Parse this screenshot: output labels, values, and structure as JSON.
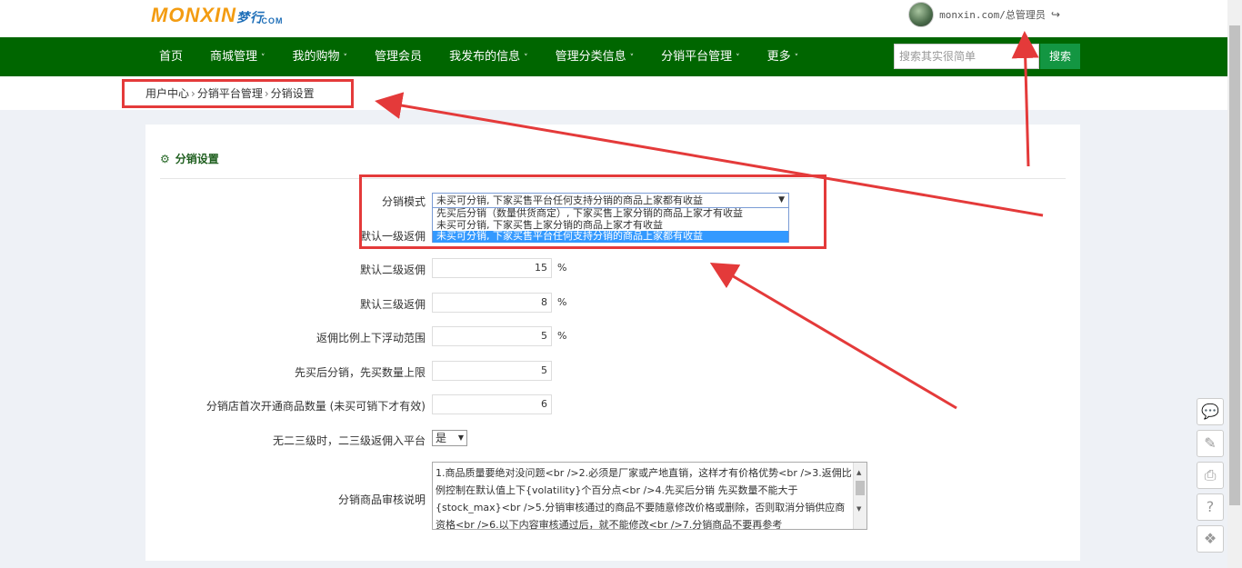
{
  "header": {
    "logo_main": "MONXIN",
    "logo_cn": "梦行",
    "logo_com": ".COM",
    "user": "monxin.com/总管理员"
  },
  "nav": {
    "items": [
      {
        "label": "首页",
        "has_caret": false
      },
      {
        "label": "商城管理",
        "has_caret": true
      },
      {
        "label": "我的购物",
        "has_caret": true
      },
      {
        "label": "管理会员",
        "has_caret": false
      },
      {
        "label": "我发布的信息",
        "has_caret": true
      },
      {
        "label": "管理分类信息",
        "has_caret": true
      },
      {
        "label": "分销平台管理",
        "has_caret": true
      },
      {
        "label": "更多",
        "has_caret": true
      }
    ],
    "search_placeholder": "搜索其实很简单",
    "search_button": "搜索"
  },
  "breadcrumb": [
    "用户中心",
    "分销平台管理",
    "分销设置"
  ],
  "panel": {
    "title": "分销设置",
    "mode_label": "分销模式",
    "mode_selected": "未买可分销, 下家买售平台任何支持分销的商品上家都有收益",
    "mode_options": [
      "先买后分销（数量供货商定）, 下家买售上家分销的商品上家才有收益",
      "未买可分销, 下家买售上家分销的商品上家才有收益",
      "未买可分销, 下家买售平台任何支持分销的商品上家都有收益"
    ],
    "fields": [
      {
        "label": "默认一级返佣",
        "value": "",
        "unit": ""
      },
      {
        "label": "默认二级返佣",
        "value": "15",
        "unit": "%"
      },
      {
        "label": "默认三级返佣",
        "value": "8",
        "unit": "%"
      },
      {
        "label": "返佣比例上下浮动范围",
        "value": "5",
        "unit": "%"
      },
      {
        "label": "先买后分销，先买数量上限",
        "value": "5",
        "unit": ""
      },
      {
        "label": "分销店首次开通商品数量 (未买可销下才有效)",
        "value": "6",
        "unit": ""
      }
    ],
    "platform_label": "无二三级时，二三级返佣入平台",
    "platform_value": "是",
    "review_label": "分销商品审核说明",
    "review_text": "1.商品质量要绝对没问题<br />2.必须是厂家或产地直销，这样才有价格优势<br />3.返佣比例控制在默认值上下{volatility}个百分点<br />4.先买后分销 先买数量不能大于{stock_max}<br />5.分销审核通过的商品不要随意修改价格或删除，否则取消分销供应商资格<br />6.以下内容审核通过后，就不能修改<br />7.分销商品不要再参考"
  },
  "side_tools": [
    "wechat-icon",
    "edit-icon",
    "print-icon",
    "help-icon",
    "share-icon"
  ],
  "colors": {
    "nav_bg": "#006600",
    "search_btn": "#139642",
    "annotation": "#e43a3a",
    "selected_option": "#3399ff"
  }
}
